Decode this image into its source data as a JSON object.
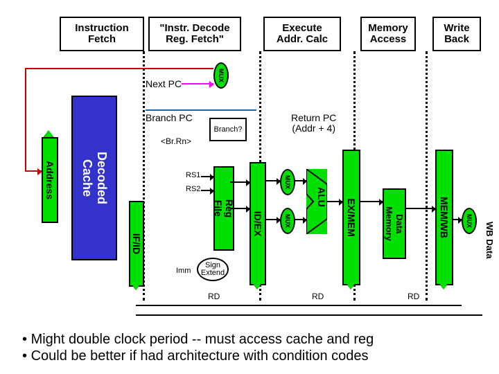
{
  "stages": {
    "if": "Instruction\nFetch",
    "id": "\"Instr. Decode\nReg. Fetch\"",
    "ex": "Execute\nAddr. Calc",
    "mem": "Memory\nAccess",
    "wb": "Write\nBack"
  },
  "labels": {
    "next_pc": "Next PC",
    "branch_pc": "Branch PC",
    "br_rn": "<Br.Rn>",
    "branch_q": "Branch?",
    "return_pc": "Return PC\n(Addr + 4)",
    "rs1": "RS1",
    "rs2": "RS2",
    "imm": "Imm",
    "sign_extend": "Sign\nExtend",
    "rd1": "RD",
    "rd2": "RD",
    "rd3": "RD",
    "address": "Address",
    "decoded_cache": "Decoded\nCache",
    "reg_file": "Reg\nFile",
    "alu": "ALU",
    "data_memory": "Data\nMemory",
    "mux": "MUX",
    "wb_data": "WB Data"
  },
  "pipes": {
    "if_id": "IF/ID",
    "id_ex": "ID/EX",
    "ex_mem": "EX/MEM",
    "mem_wb": "MEM/WB"
  },
  "notes": {
    "line1": "Might double clock period -- must access cache and reg",
    "line2": "Could be better if had architecture with condition codes"
  }
}
